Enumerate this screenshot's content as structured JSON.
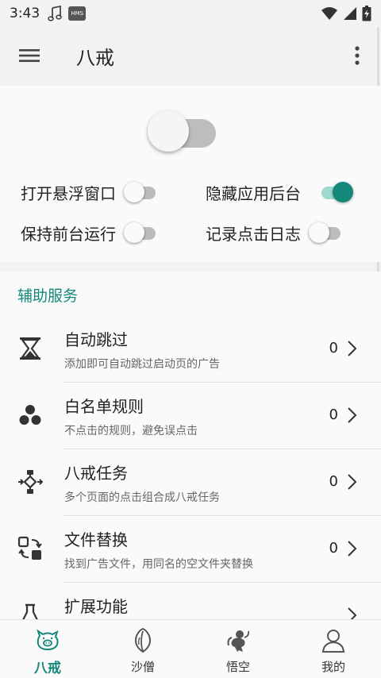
{
  "status": {
    "time": "3:43",
    "hms": "HMS"
  },
  "app_bar": {
    "title": "八戒"
  },
  "options": {
    "float_window": {
      "label": "打开悬浮窗口",
      "on": false
    },
    "hide_recent": {
      "label": "隐藏应用后台",
      "on": true
    },
    "keep_foreground": {
      "label": "保持前台运行",
      "on": false
    },
    "record_log": {
      "label": "记录点击日志",
      "on": false
    }
  },
  "services": {
    "title": "辅助服务",
    "items": [
      {
        "title": "自动跳过",
        "subtitle": "添加即可自动跳过启动页的广告",
        "count": "0",
        "icon": "hourglass-icon"
      },
      {
        "title": "白名单规则",
        "subtitle": "不点击的规则，避免误点击",
        "count": "0",
        "icon": "three-dots-icon"
      },
      {
        "title": "八戒任务",
        "subtitle": "多个页面的点击组合成八戒任务",
        "count": "0",
        "icon": "flow-icon"
      },
      {
        "title": "文件替换",
        "subtitle": "找到广告文件，用同名的空文件夹替换",
        "count": "0",
        "icon": "swap-icon"
      },
      {
        "title": "扩展功能",
        "subtitle": "",
        "count": "",
        "icon": "flask-icon"
      }
    ]
  },
  "nav": {
    "items": [
      {
        "label": "八戒",
        "icon": "pig-icon",
        "active": true
      },
      {
        "label": "沙僧",
        "icon": "leaf-icon",
        "active": false
      },
      {
        "label": "悟空",
        "icon": "monkey-icon",
        "active": false
      },
      {
        "label": "我的",
        "icon": "person-icon",
        "active": false
      }
    ]
  },
  "colors": {
    "accent": "#14897a",
    "switch_on_track": "#9ed8cf",
    "switch_off_track": "#bcbcbc"
  }
}
